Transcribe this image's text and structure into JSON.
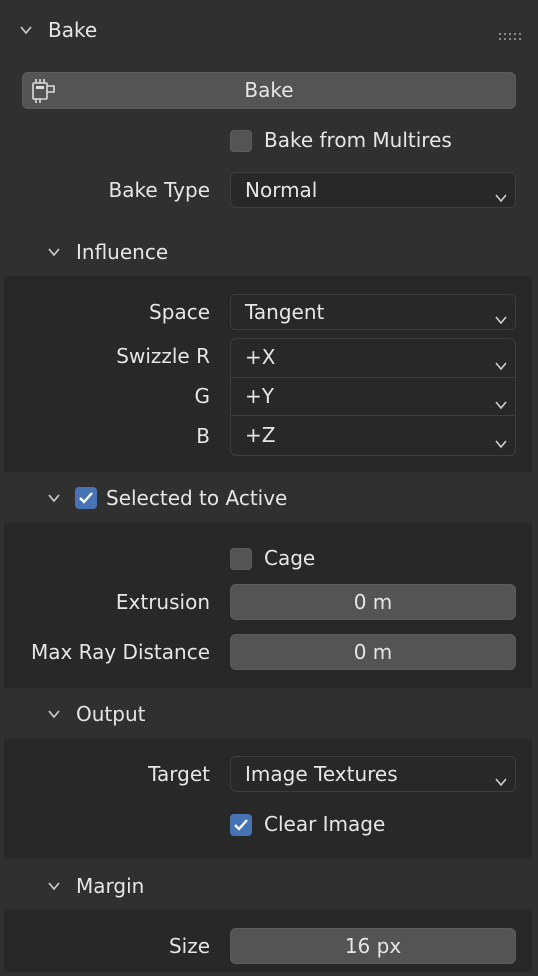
{
  "panel": {
    "title": "Bake",
    "bake_button_label": "Bake",
    "bake_from_multires": {
      "label": "Bake from Multires",
      "checked": false
    },
    "bake_type": {
      "label": "Bake Type",
      "value": "Normal"
    }
  },
  "influence": {
    "title": "Influence",
    "space": {
      "label": "Space",
      "value": "Tangent"
    },
    "swizzle_r": {
      "label": "Swizzle R",
      "value": "+X"
    },
    "swizzle_g": {
      "label": "G",
      "value": "+Y"
    },
    "swizzle_b": {
      "label": "B",
      "value": "+Z"
    }
  },
  "selected_to_active": {
    "title": "Selected to Active",
    "checked": true,
    "cage": {
      "label": "Cage",
      "checked": false
    },
    "extrusion": {
      "label": "Extrusion",
      "value": "0 m"
    },
    "max_ray_distance": {
      "label": "Max Ray Distance",
      "value": "0 m"
    }
  },
  "output": {
    "title": "Output",
    "target": {
      "label": "Target",
      "value": "Image Textures"
    },
    "clear_image": {
      "label": "Clear Image",
      "checked": true
    }
  },
  "margin": {
    "title": "Margin",
    "size": {
      "label": "Size",
      "value": "16 px"
    }
  },
  "colors": {
    "panel_bg": "#303030",
    "subpanel_bg": "#282828",
    "field_bg": "#545454",
    "dropdown_bg": "#282828",
    "checkbox_on": "#4772b3",
    "text": "#e6e6e6"
  },
  "icons": {
    "collapse": "chevron-down-icon",
    "grip": "drag-grip-icon",
    "bake": "bake-render-icon",
    "dropdown": "chevron-down-icon",
    "check": "checkmark-icon"
  }
}
